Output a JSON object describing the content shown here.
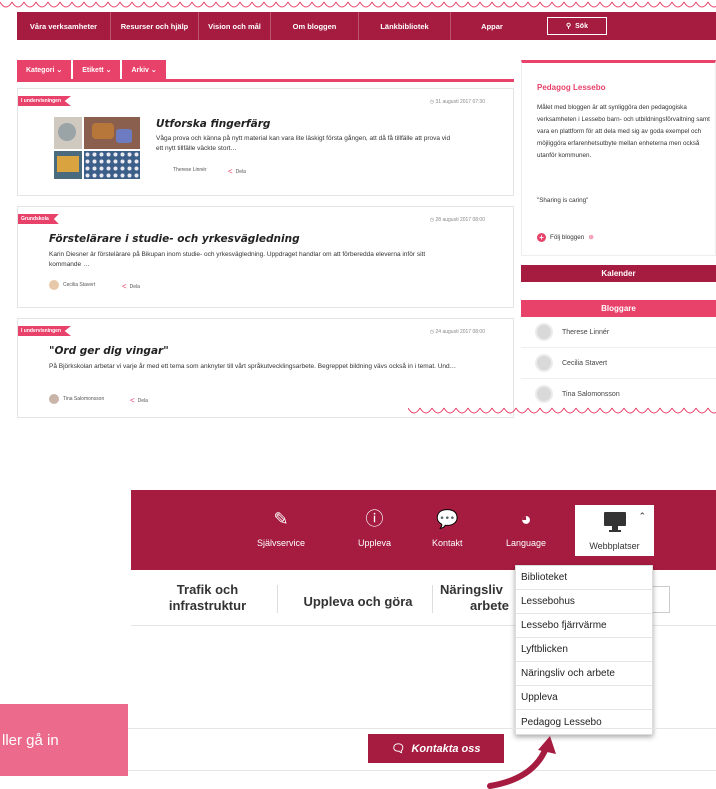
{
  "colors": {
    "brand": "#a51c40",
    "accent": "#e8416a",
    "callout": "#ec6b8c"
  },
  "top_nav": {
    "items": [
      "Våra verksamheter",
      "Resurser och hjälp",
      "Vision och mål",
      "Om bloggen",
      "Länkbibliotek",
      "Appar"
    ],
    "search_label": "Sök"
  },
  "filter_tabs": [
    "Kategori",
    "Etikett",
    "Arkiv"
  ],
  "posts": [
    {
      "category": "I undervisningen",
      "date": "31 augusti 2017 07:30",
      "title": "Utforska fingerfärg",
      "excerpt": "Våga prova och känna på nytt material kan vara lite läskigt första gången, att då få tillfälle att prova vid ett nytt tillfälle väckte stort…",
      "author": "Therese Linnér",
      "share": "Dela"
    },
    {
      "category": "Grundskola",
      "date": "28 augusti 2017 08:00",
      "title": "Förstelärare i studie- och yrkesvägledning",
      "excerpt": "Karin Diesner är förstelärare på Bikupan inom studie- och yrkesvägledning. Uppdraget handlar om att förberedda eleverna inför sitt kommande …",
      "author": "Cecilia Stavert",
      "share": "Dela"
    },
    {
      "category": "I undervisningen",
      "date": "24 augusti 2017 08:00",
      "title": "\"Ord ger dig vingar\"",
      "excerpt": "På Björkskolan arbetar vi varje år med ett tema som anknyter till vårt språkutvecklingsarbete. Begreppet bildning vävs också in i temat. Und…",
      "author": "Tina Salomonsson",
      "share": "Dela"
    }
  ],
  "sidebar": {
    "title": "Pedagog Lessebo",
    "description": "Målet med bloggen är att synliggöra den pedagogiska verksamheten i Lessebo barn- och utbildningsförvaltning samt vara en plattform för att dela med sig av goda exempel och möjliggöra erfarenhetsutbyte mellan enheterna men också utanför kommunen.",
    "quote": "\"Sharing is caring\"",
    "follow": "Följ bloggen",
    "calendar": "Kalender",
    "bloggers_title": "Bloggare",
    "bloggers": [
      "Therese Linnér",
      "Cecilia Stavert",
      "Tina Salomonsson"
    ]
  },
  "utility_nav": {
    "items": [
      {
        "label": "Självservice",
        "icon": "edit-icon"
      },
      {
        "label": "Uppleva",
        "icon": "info-icon"
      },
      {
        "label": "Kontakt",
        "icon": "chat-icon"
      },
      {
        "label": "Language",
        "icon": "globe-icon"
      }
    ],
    "webb": {
      "label": "Webbplatser",
      "icon": "monitor-icon"
    }
  },
  "secondary_nav": {
    "trafik": [
      "Trafik och",
      "infrastruktur"
    ],
    "uppleva": "Uppleva och göra",
    "naring": [
      "Näringsliv",
      "arbete"
    ]
  },
  "webb_dropdown": [
    "Biblioteket",
    "Lessebohus",
    "Lessebo fjärrvärme",
    "Lyftblicken",
    "Näringsliv och arbete",
    "Uppleva",
    "Pedagog Lessebo"
  ],
  "callout_text": "ller gå in",
  "contact_button": "Kontakta oss"
}
